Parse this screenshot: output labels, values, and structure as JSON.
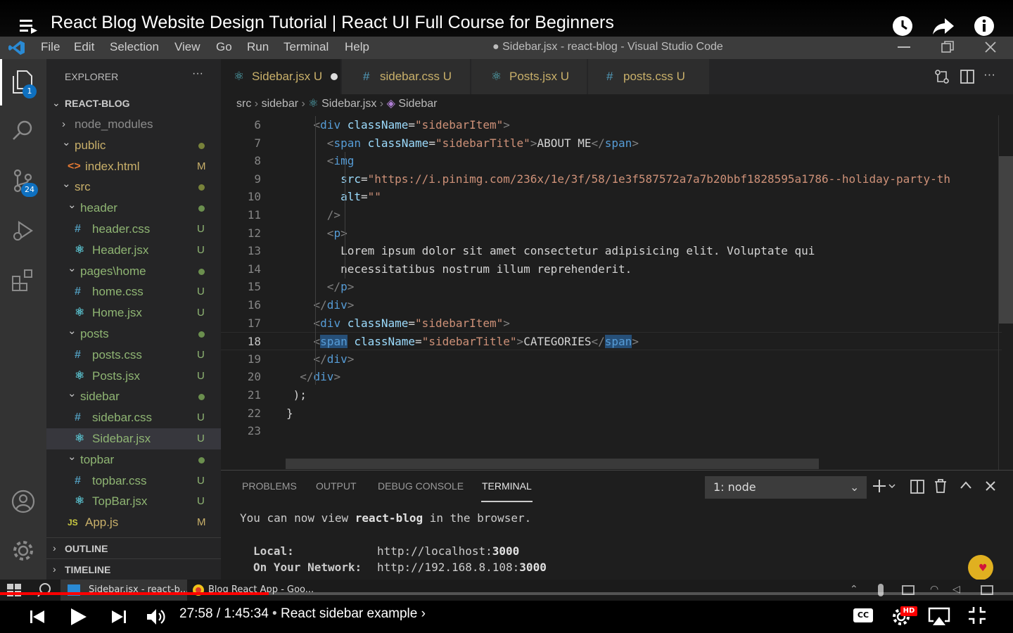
{
  "video": {
    "title": "React Blog Website Design Tutorial | React UI Full Course for Beginners",
    "time": "27:58 / 1:45:34",
    "chapter": "React sidebar example",
    "progress": 0.265,
    "quality_badge": "HD",
    "cc_label": "CC"
  },
  "window": {
    "title": "● Sidebar.jsx - react-blog - Visual Studio Code",
    "menu": [
      "File",
      "Edit",
      "Selection",
      "View",
      "Go",
      "Run",
      "Terminal",
      "Help"
    ]
  },
  "activity_bar": {
    "explorer_badge": "1",
    "scm_badge": "24"
  },
  "explorer": {
    "header": "EXPLORER",
    "more": "···",
    "root": "REACT-BLOG",
    "rows": [
      {
        "label": "node_modules",
        "kind": "folder-closed",
        "depth": 1,
        "status": "",
        "color": "#8c8c8c"
      },
      {
        "label": "public",
        "kind": "folder-open",
        "depth": 1,
        "status": "dot",
        "color": "#c9b06a"
      },
      {
        "label": "index.html",
        "kind": "html",
        "depth": 2,
        "status": "M",
        "color": "#c9b06a"
      },
      {
        "label": "src",
        "kind": "folder-open",
        "depth": 1,
        "status": "dot",
        "color": "#c9b06a"
      },
      {
        "label": "header",
        "kind": "folder-open",
        "depth": 2,
        "status": "dot-green",
        "color": "#8fb573"
      },
      {
        "label": "header.css",
        "kind": "css",
        "depth": 3,
        "status": "U",
        "color": "#8fb573"
      },
      {
        "label": "Header.jsx",
        "kind": "react",
        "depth": 3,
        "status": "U",
        "color": "#8fb573"
      },
      {
        "label": "pages\\home",
        "kind": "folder-open",
        "depth": 2,
        "status": "dot-green",
        "color": "#8fb573"
      },
      {
        "label": "home.css",
        "kind": "css",
        "depth": 3,
        "status": "U",
        "color": "#8fb573"
      },
      {
        "label": "Home.jsx",
        "kind": "react",
        "depth": 3,
        "status": "U",
        "color": "#8fb573"
      },
      {
        "label": "posts",
        "kind": "folder-open",
        "depth": 2,
        "status": "dot-green",
        "color": "#8fb573"
      },
      {
        "label": "posts.css",
        "kind": "css",
        "depth": 3,
        "status": "U",
        "color": "#8fb573"
      },
      {
        "label": "Posts.jsx",
        "kind": "react",
        "depth": 3,
        "status": "U",
        "color": "#8fb573"
      },
      {
        "label": "sidebar",
        "kind": "folder-open",
        "depth": 2,
        "status": "dot-green",
        "color": "#8fb573"
      },
      {
        "label": "sidebar.css",
        "kind": "css",
        "depth": 3,
        "status": "U",
        "color": "#8fb573"
      },
      {
        "label": "Sidebar.jsx",
        "kind": "react",
        "depth": 3,
        "status": "U",
        "color": "#8fb573",
        "selected": true
      },
      {
        "label": "topbar",
        "kind": "folder-open",
        "depth": 2,
        "status": "dot-green",
        "color": "#8fb573"
      },
      {
        "label": "topbar.css",
        "kind": "css",
        "depth": 3,
        "status": "U",
        "color": "#8fb573"
      },
      {
        "label": "TopBar.jsx",
        "kind": "react",
        "depth": 3,
        "status": "U",
        "color": "#8fb573"
      },
      {
        "label": "App.js",
        "kind": "js",
        "depth": 2,
        "status": "M",
        "color": "#c9b06a"
      }
    ],
    "outline": "OUTLINE",
    "timeline": "TIMELINE"
  },
  "tabs": [
    {
      "label": "Sidebar.jsx U",
      "icon": "react",
      "active": true,
      "dirty": true
    },
    {
      "label": "sidebar.css U",
      "icon": "css",
      "active": false
    },
    {
      "label": "Posts.jsx U",
      "icon": "react",
      "active": false
    },
    {
      "label": "posts.css U",
      "icon": "css",
      "active": false
    }
  ],
  "breadcrumb": {
    "src": "src",
    "folder": "sidebar",
    "file": "Sidebar.jsx",
    "symbol": "Sidebar"
  },
  "code": {
    "current_line": 18,
    "lines": [
      {
        "n": "6",
        "indent": "    ",
        "parts": [
          [
            "pu",
            "<"
          ],
          [
            "tg",
            "div "
          ],
          [
            "at",
            "className"
          ],
          [
            "tx",
            "="
          ],
          [
            "st",
            "\"sidebarItem\""
          ],
          [
            "pu",
            ">"
          ]
        ]
      },
      {
        "n": "7",
        "indent": "      ",
        "parts": [
          [
            "pu",
            "<"
          ],
          [
            "tg",
            "span "
          ],
          [
            "at",
            "className"
          ],
          [
            "tx",
            "="
          ],
          [
            "st",
            "\"sidebarTitle\""
          ],
          [
            "pu",
            ">"
          ],
          [
            "tx",
            "ABOUT ME"
          ],
          [
            "pu",
            "</"
          ],
          [
            "tg",
            "span"
          ],
          [
            "pu",
            ">"
          ]
        ]
      },
      {
        "n": "8",
        "indent": "      ",
        "parts": [
          [
            "pu",
            "<"
          ],
          [
            "tg",
            "img"
          ]
        ]
      },
      {
        "n": "9",
        "indent": "        ",
        "parts": [
          [
            "at",
            "src"
          ],
          [
            "tx",
            "="
          ],
          [
            "st",
            "\"https://i.pinimg.com/236x/1e/3f/58/1e3f587572a7a7b20bbf1828595a1786--holiday-party-th"
          ]
        ]
      },
      {
        "n": "10",
        "indent": "        ",
        "parts": [
          [
            "at",
            "alt"
          ],
          [
            "tx",
            "="
          ],
          [
            "st",
            "\"\""
          ]
        ]
      },
      {
        "n": "11",
        "indent": "      ",
        "parts": [
          [
            "pu",
            "/>"
          ]
        ]
      },
      {
        "n": "12",
        "indent": "      ",
        "parts": [
          [
            "pu",
            "<"
          ],
          [
            "tg",
            "p"
          ],
          [
            "pu",
            ">"
          ]
        ]
      },
      {
        "n": "13",
        "indent": "        ",
        "parts": [
          [
            "tx",
            "Lorem ipsum dolor sit amet consectetur adipisicing elit. Voluptate qui"
          ]
        ]
      },
      {
        "n": "14",
        "indent": "        ",
        "parts": [
          [
            "tx",
            "necessitatibus nostrum illum reprehenderit."
          ]
        ]
      },
      {
        "n": "15",
        "indent": "      ",
        "parts": [
          [
            "pu",
            "</"
          ],
          [
            "tg",
            "p"
          ],
          [
            "pu",
            ">"
          ]
        ]
      },
      {
        "n": "16",
        "indent": "    ",
        "parts": [
          [
            "pu",
            "</"
          ],
          [
            "tg",
            "div"
          ],
          [
            "pu",
            ">"
          ]
        ]
      },
      {
        "n": "17",
        "indent": "    ",
        "parts": [
          [
            "pu",
            "<"
          ],
          [
            "tg",
            "div "
          ],
          [
            "at",
            "className"
          ],
          [
            "tx",
            "="
          ],
          [
            "st",
            "\"sidebarItem\""
          ],
          [
            "pu",
            ">"
          ]
        ]
      },
      {
        "n": "18",
        "indent": "    ",
        "parts": [
          [
            "pu",
            "<"
          ],
          [
            "tg",
            "span"
          ],
          [
            "tx",
            " "
          ],
          [
            "at",
            "className"
          ],
          [
            "tx",
            "="
          ],
          [
            "st",
            "\"sidebarTitle\""
          ],
          [
            "pu",
            ">"
          ],
          [
            "tx",
            "CATEGORIES"
          ],
          [
            "pu",
            "</"
          ],
          [
            "tg",
            "span"
          ],
          [
            "pu",
            ">"
          ]
        ]
      },
      {
        "n": "19",
        "indent": "    ",
        "parts": [
          [
            "pu",
            "</"
          ],
          [
            "tg",
            "div"
          ],
          [
            "pu",
            ">"
          ]
        ]
      },
      {
        "n": "20",
        "indent": "  ",
        "parts": [
          [
            "pu",
            "</"
          ],
          [
            "tg",
            "div"
          ],
          [
            "pu",
            ">"
          ]
        ]
      },
      {
        "n": "21",
        "indent": " ",
        "parts": [
          [
            "tx",
            ");"
          ]
        ]
      },
      {
        "n": "22",
        "indent": "",
        "parts": [
          [
            "tx",
            "}"
          ]
        ]
      },
      {
        "n": "23",
        "indent": "",
        "parts": []
      }
    ]
  },
  "panel": {
    "tabs": [
      "PROBLEMS",
      "OUTPUT",
      "DEBUG CONSOLE",
      "TERMINAL"
    ],
    "active_tab": "TERMINAL",
    "terminal_select": "1: node",
    "terminal": {
      "line1_a": "You can now view ",
      "line1_b": "react-blog",
      "line1_c": " in the browser.",
      "local_label": "Local:",
      "local_url": "http://localhost:",
      "local_port": "3000",
      "network_label": "On Your Network:",
      "network_url": "http://192.168.8.108:",
      "network_port": "3000"
    }
  },
  "taskbar": {
    "items": [
      "Sidebar.jsx - react-b...",
      "Blog React App - Goo..."
    ]
  }
}
